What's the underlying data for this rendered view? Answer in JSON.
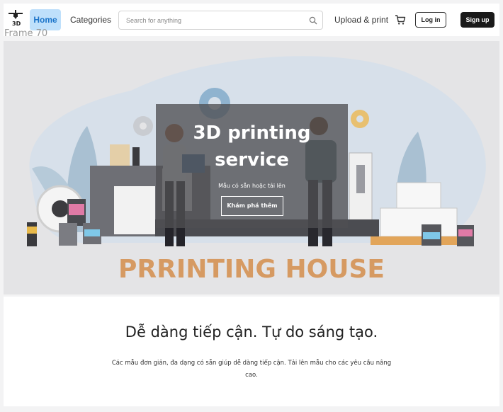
{
  "frame_label": "Frame 70",
  "nav": {
    "logo_text": "3D",
    "home_label": "Home",
    "categories_label": "Categories",
    "upload_label": "Upload & print",
    "login_label": "Log in",
    "signup_label": "Sign up",
    "home_active_color": "#bfe0fb"
  },
  "search": {
    "placeholder": "Search for anything",
    "value": ""
  },
  "hero": {
    "title": "3D printing service",
    "subtitle": "Mẫu có sẵn hoặc tải lên",
    "button_label": "Khám phá thêm",
    "brand": "PRRINTING HOUSE",
    "brand_color": "#d69a62"
  },
  "section": {
    "title": "Dễ dàng tiếp cận. Tự do sáng tạo.",
    "body": "Các mẫu đơn giản, đa dạng có sẵn giúp dễ dàng tiếp cận. Tải lên mẫu cho các yêu cầu nâng cao."
  },
  "icons": [
    "logo-icon",
    "search-icon",
    "cart-icon"
  ]
}
